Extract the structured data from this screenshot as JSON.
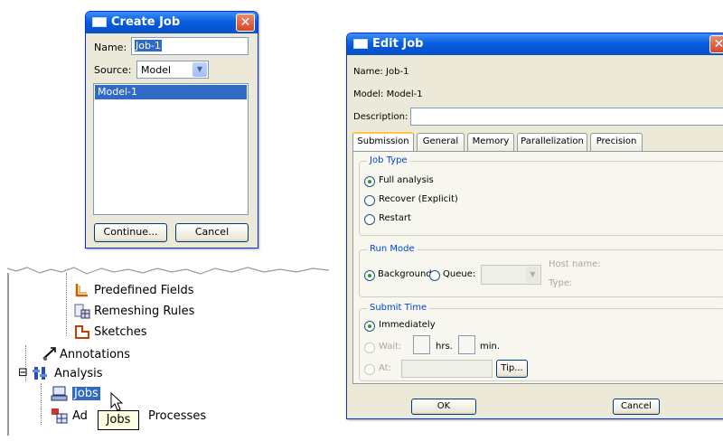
{
  "create_job": {
    "title": "Create Job",
    "close_glyph": "✕",
    "name_label": "Name:",
    "name_value": "Job-1",
    "source_label": "Source:",
    "source_value": "Model",
    "model_list": [
      "Model-1"
    ],
    "continue_label": "Continue...",
    "cancel_label": "Cancel"
  },
  "tree": {
    "items": [
      {
        "label": "Predefined Fields",
        "icon": "predefined-fields-icon"
      },
      {
        "label": "Remeshing Rules",
        "icon": "remeshing-rules-icon"
      },
      {
        "label": "Sketches",
        "icon": "sketches-icon"
      },
      {
        "label": "Annotations",
        "icon": "annotations-icon"
      },
      {
        "label": "Analysis",
        "icon": "analysis-icon",
        "expander": "⊟"
      },
      {
        "label": "Jobs",
        "icon": "jobs-icon",
        "selected": true
      },
      {
        "label": "Processes",
        "prefix": "Ad",
        "icon": "adaptivity-processes-icon"
      }
    ],
    "tooltip": "Jobs"
  },
  "edit_job": {
    "title": "Edit Job",
    "close_glyph": "✕",
    "name_line": "Name:  Job-1",
    "model_line": "Model:  Model-1",
    "description_label": "Description:",
    "description_value": "",
    "tabs": [
      "Submission",
      "General",
      "Memory",
      "Parallelization",
      "Precision"
    ],
    "active_tab": "Submission",
    "job_type": {
      "title": "Job Type",
      "options": [
        "Full analysis",
        "Recover (Explicit)",
        "Restart"
      ],
      "selected": "Full analysis"
    },
    "run_mode": {
      "title": "Run Mode",
      "background_label": "Background",
      "queue_label": "Queue:",
      "queue_value": "",
      "host_name_label": "Host name:",
      "type_label": "Type:",
      "selected": "Background"
    },
    "submit_time": {
      "title": "Submit Time",
      "immediately_label": "Immediately",
      "wait_label": "Wait:",
      "hrs_label": "hrs.",
      "min_label": "min.",
      "at_label": "At:",
      "tip_label": "Tip...",
      "selected": "Immediately"
    },
    "ok_label": "OK",
    "cancel_label": "Cancel"
  },
  "colors": {
    "titlebar": "#0a5fe0",
    "dialog_bg": "#ece9d8",
    "selection": "#316ac5",
    "group_title": "#0046d5",
    "radio_dot": "#21a121"
  }
}
